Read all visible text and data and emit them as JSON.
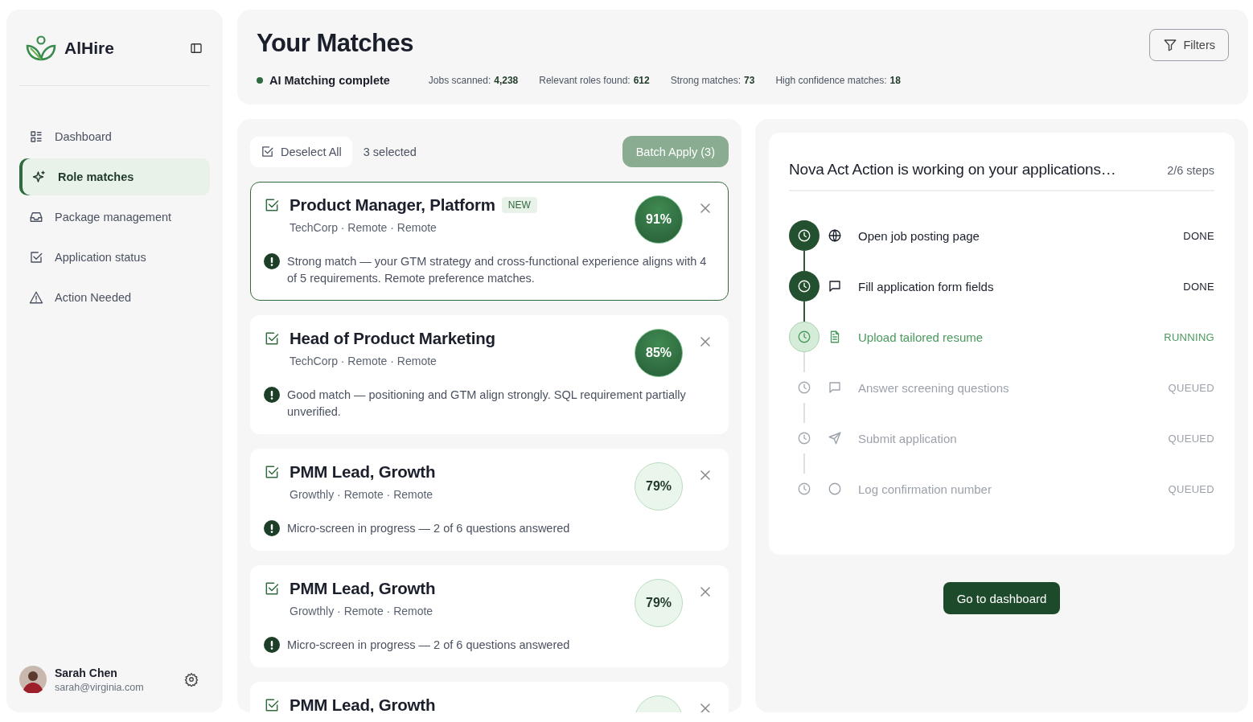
{
  "sidebar": {
    "brand": "AlHire",
    "items": [
      {
        "label": "Dashboard",
        "selected": false
      },
      {
        "label": "Role matches",
        "selected": true
      },
      {
        "label": "Package management",
        "selected": false
      },
      {
        "label": "Application status",
        "selected": false
      },
      {
        "label": "Action Needed",
        "selected": false
      }
    ],
    "user": {
      "name": "Sarah Chen",
      "email": "sarah@virginia.com"
    }
  },
  "header": {
    "title": "Your Matches",
    "status": "AI Matching complete",
    "filters": "Filters",
    "stats": [
      {
        "label": "Jobs scanned:",
        "value": "4,238"
      },
      {
        "label": "Relevant roles found:",
        "value": "612"
      },
      {
        "label": "Strong matches:",
        "value": "73"
      },
      {
        "label": "High confidence matches:",
        "value": "18"
      }
    ]
  },
  "matches": {
    "deselect": "Deselect All",
    "selected_count": "3 selected",
    "batch_apply": "Batch Apply (3)",
    "cards": [
      {
        "title": "Product Manager, Platform",
        "badge": "NEW",
        "meta": "TechCorp · Remote · Remote",
        "score": "91%",
        "kind": "strong",
        "checked": true,
        "selected": true,
        "note": "Strong match — your GTM strategy and cross-functional experience aligns with 4 of 5 requirements. Remote preference matches."
      },
      {
        "title": "Head of Product Marketing",
        "meta": "TechCorp · Remote · Remote",
        "score": "85%",
        "kind": "strong",
        "checked": true,
        "selected": false,
        "note": "Good match — positioning and GTM align strongly. SQL requirement partially unverified."
      },
      {
        "title": "PMM Lead, Growth",
        "meta": "Growthly · Remote · Remote",
        "score": "79%",
        "kind": "moderate",
        "checked": true,
        "selected": false,
        "note": "Micro-screen in progress — 2 of 6 questions answered"
      },
      {
        "title": "PMM Lead, Growth",
        "meta": "Growthly · Remote · Remote",
        "score": "79%",
        "kind": "moderate",
        "checked": true,
        "selected": false,
        "note": "Micro-screen in progress — 2 of 6 questions answered"
      },
      {
        "title": "PMM Lead, Growth",
        "kind": "moderate",
        "checked": true,
        "selected": false
      }
    ]
  },
  "progress": {
    "title": "Nova Act Action is working on your applications…",
    "steps_count": "2/6 steps",
    "steps": [
      {
        "label": "Open job posting page",
        "status": "DONE",
        "kind": "done"
      },
      {
        "label": "Fill application form fields",
        "status": "DONE",
        "kind": "done"
      },
      {
        "label": "Upload tailored resume",
        "status": "RUNNING",
        "kind": "running"
      },
      {
        "label": "Answer screening questions",
        "status": "QUEUED",
        "kind": "queued"
      },
      {
        "label": "Submit application",
        "status": "QUEUED",
        "kind": "queued"
      },
      {
        "label": "Log confirmation number",
        "status": "QUEUED",
        "kind": "queued"
      }
    ],
    "button": "Go to dashboard"
  }
}
